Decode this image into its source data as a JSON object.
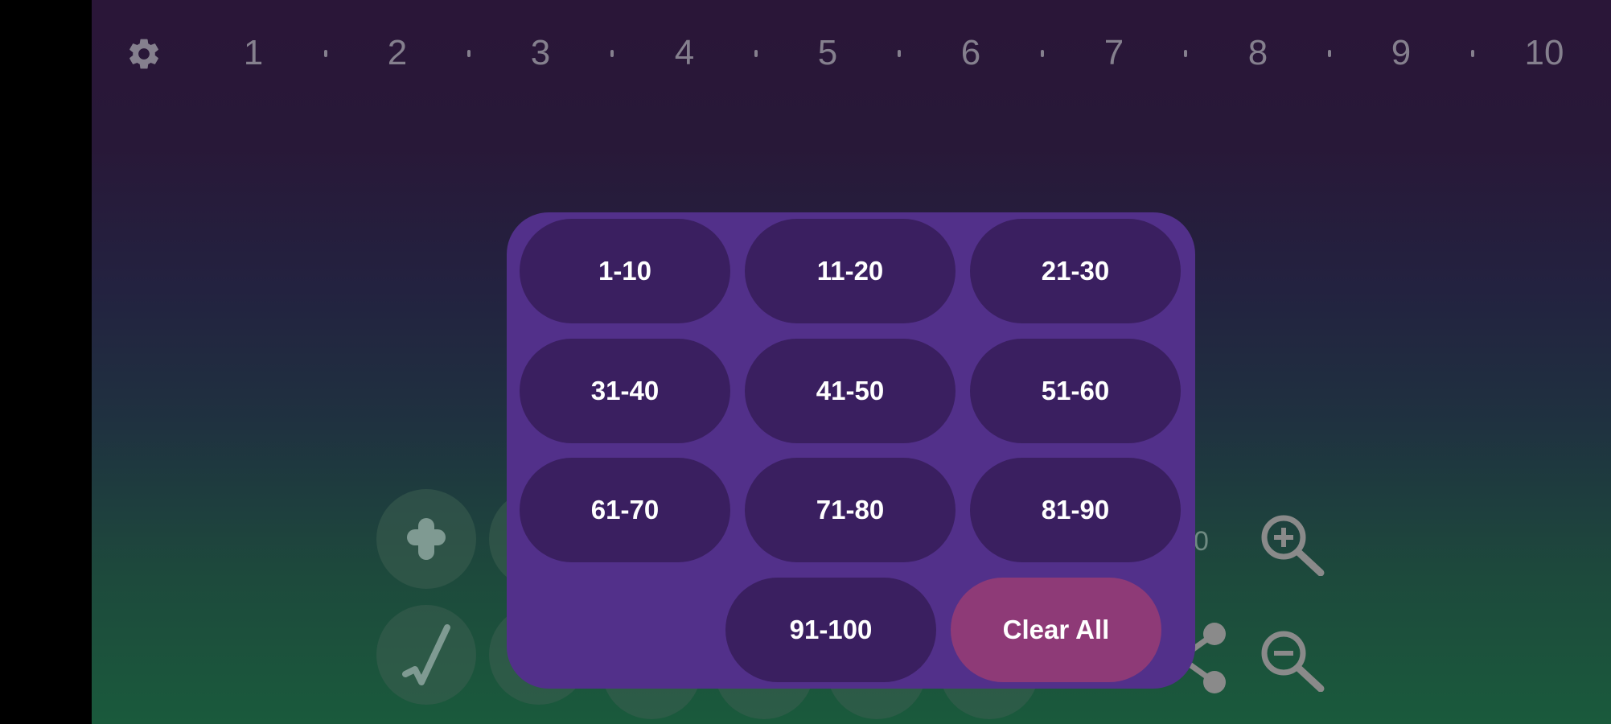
{
  "ruler": {
    "numbers": [
      "1",
      "2",
      "3",
      "4",
      "5",
      "6",
      "7",
      "8",
      "9",
      "10"
    ]
  },
  "icons": {
    "settings": "gear-icon",
    "add": "plus-icon",
    "check": "checkmark-icon",
    "share": "share-icon",
    "zoom_in": "zoom-in-icon",
    "zoom_out": "zoom-out-icon"
  },
  "background": {
    "counter_text": "0"
  },
  "range_picker": {
    "ranges": [
      "1-10",
      "11-20",
      "21-30",
      "31-40",
      "41-50",
      "51-60",
      "61-70",
      "71-80",
      "81-90",
      "91-100"
    ],
    "clear_label": "Clear All"
  },
  "colors": {
    "popup": "#52308a",
    "button": "#3a1f60",
    "clear_button": "#8e3a77",
    "ruler_text": "#85808e"
  }
}
